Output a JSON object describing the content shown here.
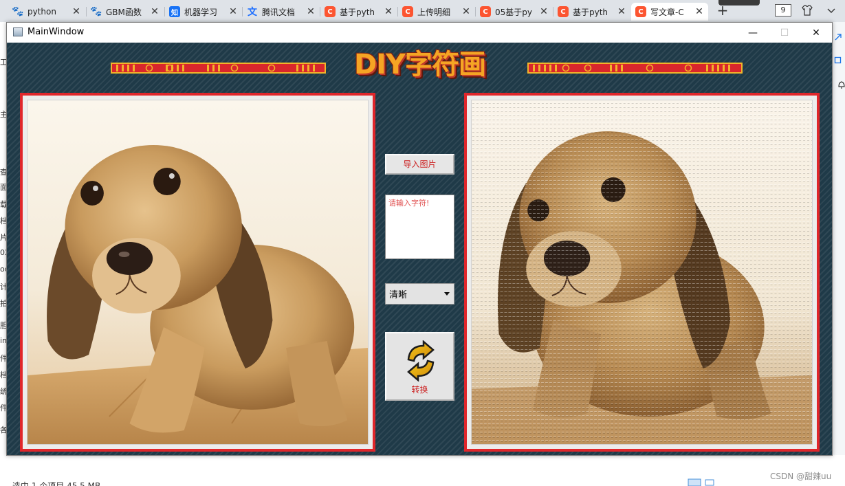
{
  "browser": {
    "tabs": [
      {
        "title": "python",
        "icon": "paw-icon"
      },
      {
        "title": "GBM函数",
        "icon": "paw-icon"
      },
      {
        "title": "机器学习",
        "icon": "zhihu-icon"
      },
      {
        "title": "腾讯文档",
        "icon": "tencent-docs-icon"
      },
      {
        "title": "基于pyth",
        "icon": "csdn-icon"
      },
      {
        "title": "上传明细",
        "icon": "csdn-icon"
      },
      {
        "title": "05基于py",
        "icon": "csdn-icon"
      },
      {
        "title": "基于pyth",
        "icon": "csdn-icon"
      },
      {
        "title": "写文章-C",
        "icon": "csdn-icon",
        "active": true
      }
    ],
    "fav_labels": {
      "paw": "🐾",
      "zhi": "知",
      "tx": "文",
      "csdn": "C"
    },
    "close_glyph": "✕",
    "new_tab_glyph": "+",
    "tab_count_badge": "9"
  },
  "explorer_bg": {
    "left_fragments": [
      "工",
      "主",
      "查",
      "面",
      "载",
      "档",
      "片",
      "02",
      "oc",
      "计",
      "拍",
      "胆",
      "in",
      "件",
      "档",
      "统",
      "件",
      "各"
    ],
    "status_text": "选中 1 个项目  45.5 MB",
    "watermark": "CSDN @甜辣uu"
  },
  "window": {
    "title": "MainWindow",
    "controls": {
      "minimize": "—",
      "maximize": "☐",
      "close": "✕"
    }
  },
  "app": {
    "logo_text": "DIY字符画",
    "import_button_label": "导入图片",
    "text_input_placeholder": "请输入字符!",
    "text_input_value": "",
    "clarity_select": {
      "selected": "清晰"
    },
    "convert_button_label": "转换"
  },
  "colors": {
    "panel_border": "#e0262b",
    "label_red": "#cc1f1f",
    "background": "#1f3a48",
    "logo_fill": "#f5a524"
  }
}
